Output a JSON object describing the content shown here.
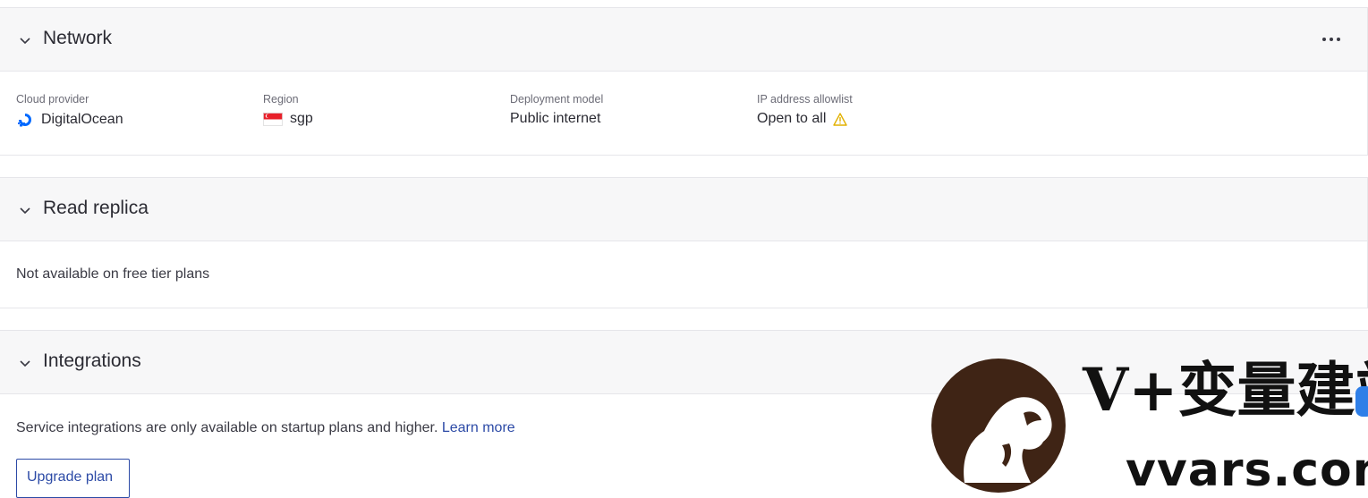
{
  "network": {
    "title": "Network",
    "fields": [
      {
        "label": "Cloud provider",
        "value": "DigitalOcean",
        "icon": "digitalocean-icon"
      },
      {
        "label": "Region",
        "value": "sgp",
        "icon": "singapore-flag-icon"
      },
      {
        "label": "Deployment model",
        "value": "Public internet"
      },
      {
        "label": "IP address allowlist",
        "value": "Open to all",
        "icon": "warning-icon"
      }
    ]
  },
  "read_replica": {
    "title": "Read replica",
    "message": "Not available on free tier plans"
  },
  "integrations": {
    "title": "Integrations",
    "message": "Service integrations are only available on startup plans and higher.",
    "link_label": "Learn more",
    "button_label": "Upgrade plan"
  },
  "watermark": {
    "line1": "V+变量建站",
    "line2": "vvars.com"
  },
  "colors": {
    "accent": "#2c4aa6",
    "warning": "#e2b100",
    "digitalocean": "#0069ff",
    "header_bg": "#f7f7f8"
  }
}
